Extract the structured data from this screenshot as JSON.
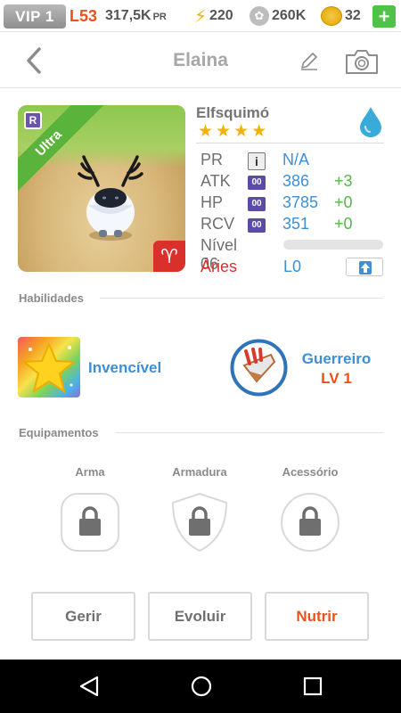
{
  "status": {
    "vip": "VIP 1",
    "level": "L53",
    "pr_value": "317,5K",
    "pr_unit": "PR",
    "energy": "220",
    "paw": "260K",
    "coins": "32",
    "plus": "+"
  },
  "header": {
    "title": "Elaina"
  },
  "pet": {
    "rank_badge": "R",
    "rarity": "Ultra",
    "species": "Elfsquimó",
    "stars": 4,
    "star_glyph": "★",
    "sign_symbol": "♈",
    "stats": [
      {
        "label": "PR",
        "icon": "i",
        "value": "N/A",
        "bonus": ""
      },
      {
        "label": "ATK",
        "icon": "00",
        "value": "386",
        "bonus": "+3"
      },
      {
        "label": "HP",
        "icon": "00",
        "value": "3785",
        "bonus": "+0"
      },
      {
        "label": "RCV",
        "icon": "00",
        "value": "351",
        "bonus": "+0"
      }
    ],
    "level_label": "Nível 06",
    "level_progress": 0,
    "sign": "Áries",
    "rank": "L0"
  },
  "abilities": {
    "title": "Habilidades",
    "skill": "Invencível",
    "class_name": "Guerreiro",
    "class_level": "LV 1"
  },
  "equipment": {
    "title": "Equipamentos",
    "slots": [
      "Arma",
      "Armadura",
      "Acessório"
    ]
  },
  "actions": {
    "manage": "Gerir",
    "evolve": "Evoluir",
    "feed": "Nutrir"
  },
  "colors": {
    "accent_blue": "#3d8fd6",
    "accent_orange": "#e8521c",
    "bonus_green": "#56b54a",
    "sign_red": "#d9302c",
    "rarity_green": "#5ab43c"
  }
}
